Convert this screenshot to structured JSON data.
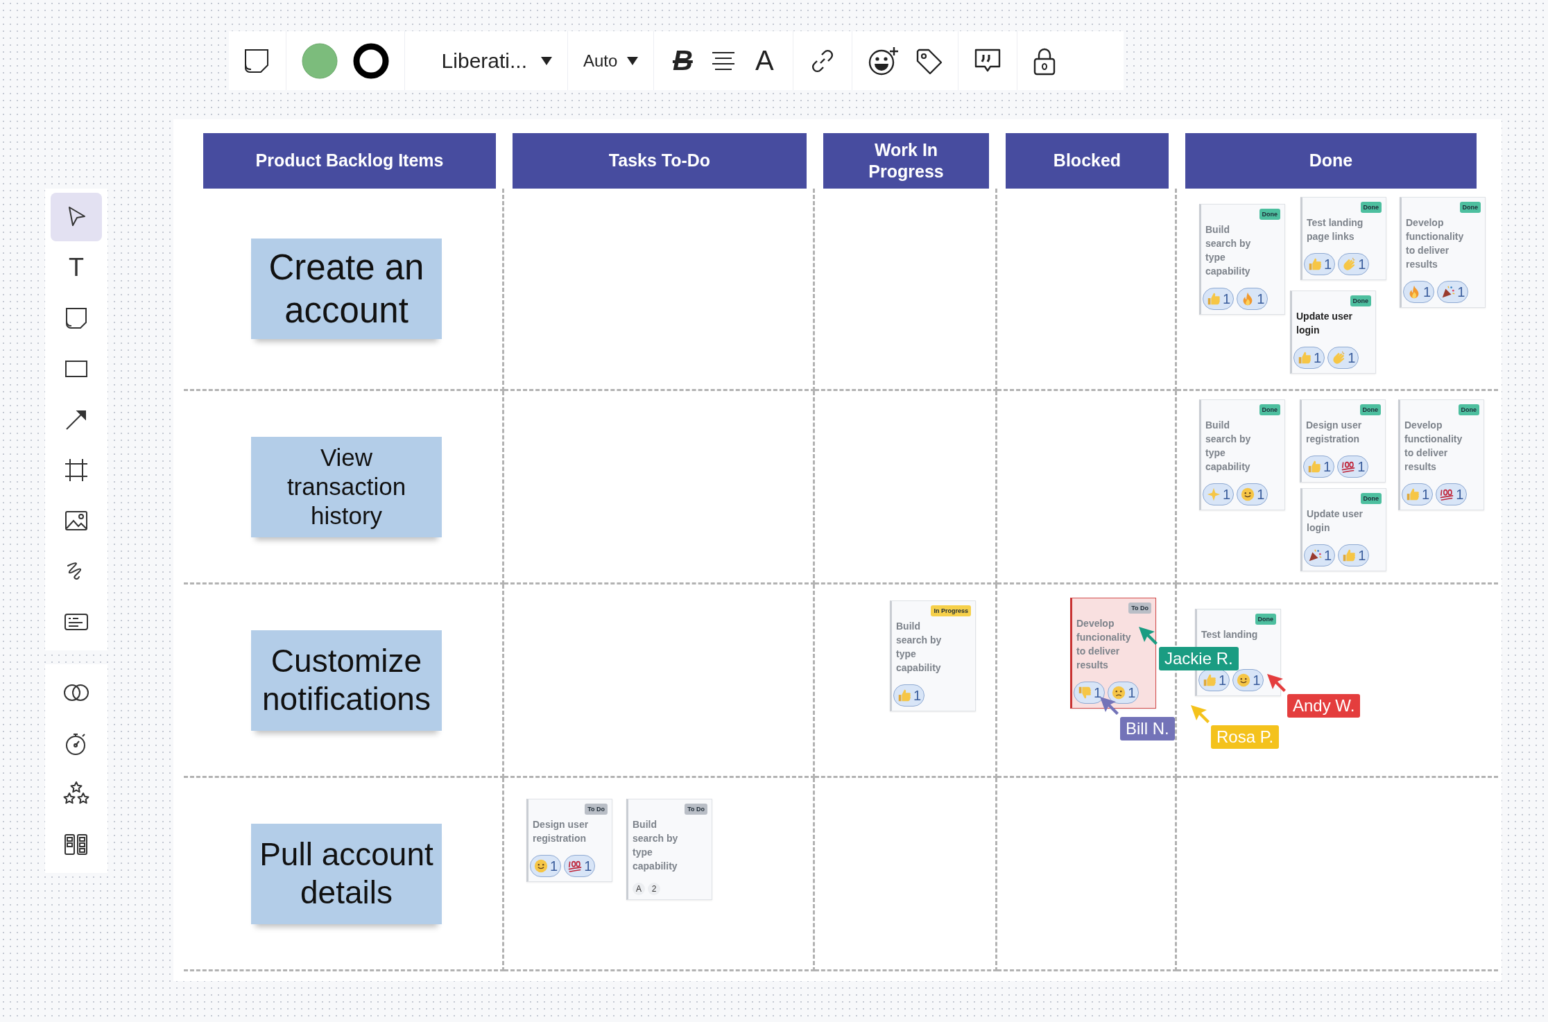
{
  "toolbar": {
    "bold_glyph": "B",
    "text_color_glyph": "A",
    "font": "Liberati...",
    "size": "Auto"
  },
  "tools": [
    {
      "kind": "select",
      "selected": true
    },
    {
      "kind": "text",
      "glyph": "T",
      "selected": false
    },
    {
      "kind": "sticky",
      "selected": false
    },
    {
      "kind": "rectangle",
      "selected": false
    },
    {
      "kind": "arrow",
      "selected": false
    },
    {
      "kind": "frame",
      "selected": false
    },
    {
      "kind": "image",
      "selected": false
    },
    {
      "kind": "pen",
      "selected": false
    },
    {
      "kind": "card",
      "selected": false
    }
  ],
  "extra_tools": [
    {
      "kind": "venn",
      "selected": false
    },
    {
      "kind": "timer",
      "selected": false
    },
    {
      "kind": "stars",
      "selected": false
    },
    {
      "kind": "template",
      "selected": false
    }
  ],
  "columns": [
    "Product Backlog Items",
    "Tasks To-Do",
    "Work In Progress",
    "Blocked",
    "Done"
  ],
  "rows": [
    {
      "backlog": "Create an account",
      "done": [
        {
          "kind": "done",
          "tag": "Done",
          "title": "Build search by type capability",
          "blurred": true,
          "alert": false,
          "reactions": [
            {
              "kind": "thumbs-up",
              "count": "1"
            },
            {
              "kind": "fire",
              "count": "1"
            }
          ]
        },
        {
          "kind": "done",
          "tag": "Done",
          "title": "Test landing page links",
          "blurred": true,
          "alert": false,
          "reactions": [
            {
              "kind": "thumbs-up",
              "count": "1"
            },
            {
              "kind": "clap",
              "count": "1"
            }
          ]
        },
        {
          "kind": "done",
          "tag": "Done",
          "title": "Develop functionality to deliver results",
          "blurred": true,
          "alert": false,
          "reactions": [
            {
              "kind": "fire",
              "count": "1"
            },
            {
              "kind": "party",
              "count": "1"
            }
          ]
        },
        {
          "kind": "done",
          "tag": "Done",
          "title": "Update user login",
          "blurred": false,
          "alert": false,
          "reactions": [
            {
              "kind": "thumbs-up",
              "count": "1"
            },
            {
              "kind": "clap",
              "count": "1"
            }
          ]
        }
      ]
    },
    {
      "backlog": "View transaction history",
      "done": [
        {
          "kind": "done",
          "tag": "Done",
          "title": "Build search by type capability",
          "blurred": true,
          "alert": false,
          "reactions": [
            {
              "kind": "sparkle",
              "count": "1"
            },
            {
              "kind": "smile",
              "count": "1"
            }
          ]
        },
        {
          "kind": "done",
          "tag": "Done",
          "title": "Design user registration",
          "blurred": true,
          "alert": false,
          "reactions": [
            {
              "kind": "thumbs-up",
              "count": "1"
            },
            {
              "kind": "hundred",
              "count": "1"
            }
          ]
        },
        {
          "kind": "done",
          "tag": "Done",
          "title": "Develop functionality to deliver results",
          "blurred": true,
          "alert": false,
          "reactions": [
            {
              "kind": "thumbs-up",
              "count": "1"
            },
            {
              "kind": "hundred",
              "count": "1"
            }
          ]
        },
        {
          "kind": "done",
          "tag": "Done",
          "title": "Update user login",
          "blurred": true,
          "alert": false,
          "reactions": [
            {
              "kind": "party",
              "count": "1"
            },
            {
              "kind": "thumbs-up",
              "count": "1"
            }
          ]
        }
      ]
    },
    {
      "backlog": "Customize notifications",
      "in_progress": [
        {
          "kind": "in_progress",
          "tag": "In Progress",
          "title": "Build search by type capability",
          "blurred": true,
          "alert": false,
          "reactions": [
            {
              "kind": "thumbs-up",
              "count": "1"
            }
          ]
        }
      ],
      "blocked": [
        {
          "kind": "todo",
          "tag": "To Do",
          "title": "Develop funcionality to deliver results",
          "blurred": true,
          "alert": true,
          "reactions": [
            {
              "kind": "thumbs-down",
              "count": "1"
            },
            {
              "kind": "frown",
              "count": "1"
            }
          ]
        }
      ],
      "done": [
        {
          "kind": "done",
          "tag": "Done",
          "title": "Test landing",
          "blurred": true,
          "alert": false,
          "reactions": [
            {
              "kind": "thumbs-up",
              "count": "1"
            },
            {
              "kind": "smile",
              "count": "1"
            }
          ]
        }
      ]
    },
    {
      "backlog": "Pull account details",
      "todo": [
        {
          "kind": "todo",
          "tag": "To Do",
          "title": "Design user registration",
          "blurred": true,
          "alert": false,
          "reactions": [
            {
              "kind": "smile",
              "count": "1"
            },
            {
              "kind": "hundred",
              "count": "1"
            }
          ]
        },
        {
          "kind": "todo",
          "tag": "To Do",
          "title": "Build search by type capability",
          "blurred": true,
          "alert": false,
          "footer_badges": [
            "A",
            "2"
          ]
        }
      ]
    }
  ],
  "cursors": [
    {
      "name": "Jackie R.",
      "color": "#1a9c82"
    },
    {
      "name": "Andy W.",
      "color": "#e43d3d"
    },
    {
      "name": "Bill N.",
      "color": "#7373b8"
    },
    {
      "name": "Rosa P.",
      "color": "#f4c21c"
    }
  ]
}
